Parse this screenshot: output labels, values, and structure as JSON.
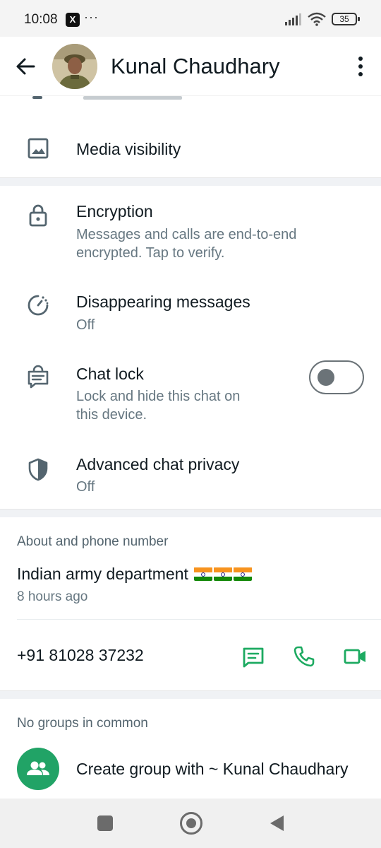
{
  "status_bar": {
    "time": "10:08",
    "notification_x": "X",
    "more_dots": "···",
    "battery": "35"
  },
  "header": {
    "contact_name": "Kunal Chaudhary"
  },
  "media": {
    "title": "Media visibility"
  },
  "privacy": {
    "encryption_title": "Encryption",
    "encryption_sub_line1": "Messages and calls are end-to-end",
    "encryption_sub_line2": "encrypted. Tap to verify.",
    "disappearing_title": "Disappearing messages",
    "disappearing_sub": "Off",
    "chat_lock_title": "Chat lock",
    "chat_lock_sub_line1": "Lock and hide this chat on",
    "chat_lock_sub_line2": "this device.",
    "chat_lock_enabled": false,
    "advanced_title": "Advanced chat privacy",
    "advanced_sub": "Off"
  },
  "about": {
    "section_label": "About and phone number",
    "about_text": "Indian army department",
    "about_emojis": "🇮🇳🇮🇳🇮🇳",
    "about_time": "8 hours ago",
    "phone_number": "+91 81028 37232"
  },
  "groups": {
    "section_label": "No groups in common",
    "create_group": "Create group with ~ Kunal Chaudhary"
  },
  "colors": {
    "accent_green": "#1daa61",
    "text_primary": "#111b21",
    "text_secondary": "#667781",
    "icon_gray": "#54656f"
  },
  "icons": {
    "back": "arrow-left-icon",
    "menu": "more-vertical-icon",
    "media": "image-icon",
    "encryption": "lock-icon",
    "disappearing": "timer-icon",
    "chat_lock": "chat-lock-icon",
    "advanced": "shield-icon",
    "message": "message-icon",
    "call": "phone-icon",
    "video": "video-icon",
    "group": "group-icon"
  }
}
